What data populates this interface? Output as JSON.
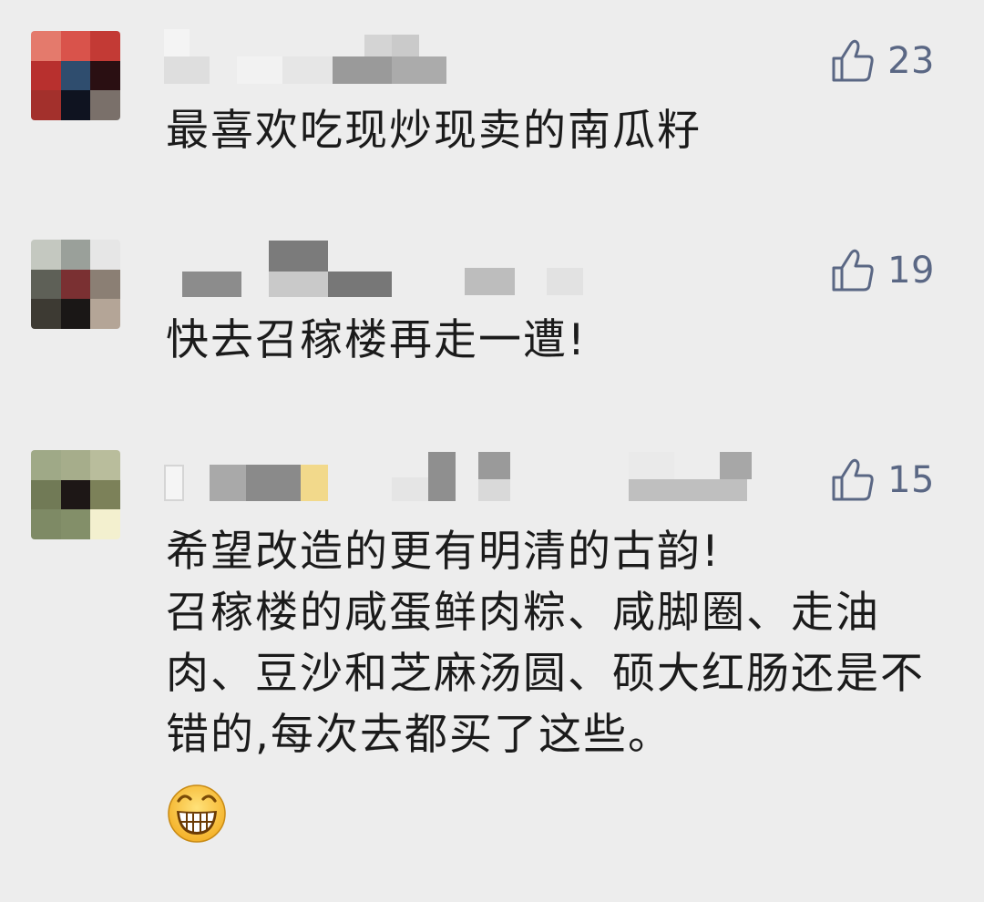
{
  "comments": [
    {
      "text": "最喜欢吃现炒现卖的南瓜籽",
      "likes": "23",
      "avatar_colors": [
        "#e47a6c",
        "#d9534b",
        "#c33a35",
        "#b8302e",
        "#2f4d6e",
        "#2a0f12",
        "#a3302c",
        "#0f1320",
        "#7a706a"
      ]
    },
    {
      "text": "快去召稼楼再走一遭!",
      "likes": "19",
      "avatar_colors": [
        "#c4c8c0",
        "#9aa09a",
        "#e6e6e6",
        "#5e6057",
        "#7a3032",
        "#8b7f74",
        "#3d3a33",
        "#1a1716",
        "#b4a597"
      ]
    },
    {
      "text": "希望改造的更有明清的古韵!\n召稼楼的咸蛋鲜肉粽、咸脚圈、走油肉、豆沙和芝麻汤圆、硕大红肠还是不错的,每次去都买了这些。",
      "likes": "15",
      "avatar_colors": [
        "#9fa987",
        "#a6ad8b",
        "#b9bd9c",
        "#717a56",
        "#1d1716",
        "#7c8159",
        "#7e8a65",
        "#838f69",
        "#f3f0cf"
      ],
      "has_emoji": true
    }
  ],
  "icons": {
    "like": "thumbs-up-icon",
    "emoji": "grinning-face-icon"
  },
  "colors": {
    "background": "#ededed",
    "text": "#1b1b1b",
    "like": "#5a6784"
  }
}
